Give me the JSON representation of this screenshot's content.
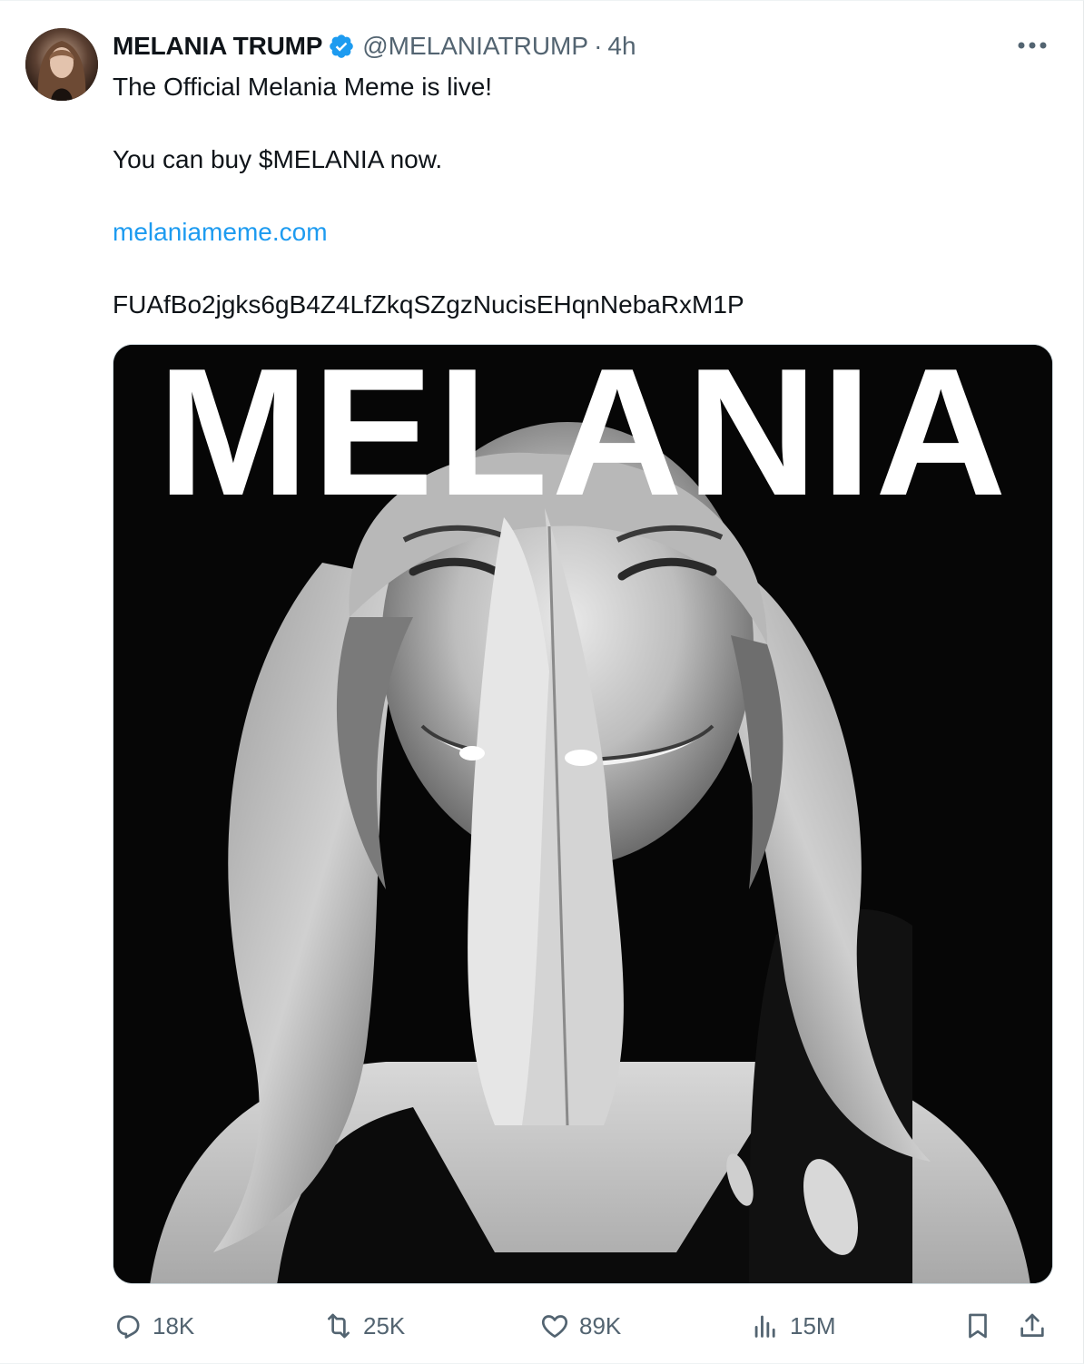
{
  "tweet": {
    "author": {
      "display_name": "MELANIA TRUMP",
      "handle": "@MELANIATRUMP",
      "separator": "·",
      "time_ago": "4h",
      "verified": true,
      "avatar_icon": "profile-photo"
    },
    "more_icon": "more-horizontal-icon",
    "text": {
      "line1": "The Official Melania Meme is live!",
      "line2": "You can buy $MELANIA now.",
      "link": "melaniameme.com",
      "contract": "FUAfBo2jgks6gB4Z4LfZkqSZgzNucisEHqnNebaRxM1P"
    },
    "media": {
      "overlay_title": "MELANIA",
      "kind": "black-and-white portrait photo"
    },
    "actions": {
      "replies": "18K",
      "reposts": "25K",
      "likes": "89K",
      "views": "15M"
    }
  },
  "colors": {
    "text_primary": "#0f1419",
    "text_secondary": "#536471",
    "link": "#1d9bf0",
    "verified_badge": "#1d9bf0",
    "border": "#cfd9de"
  }
}
